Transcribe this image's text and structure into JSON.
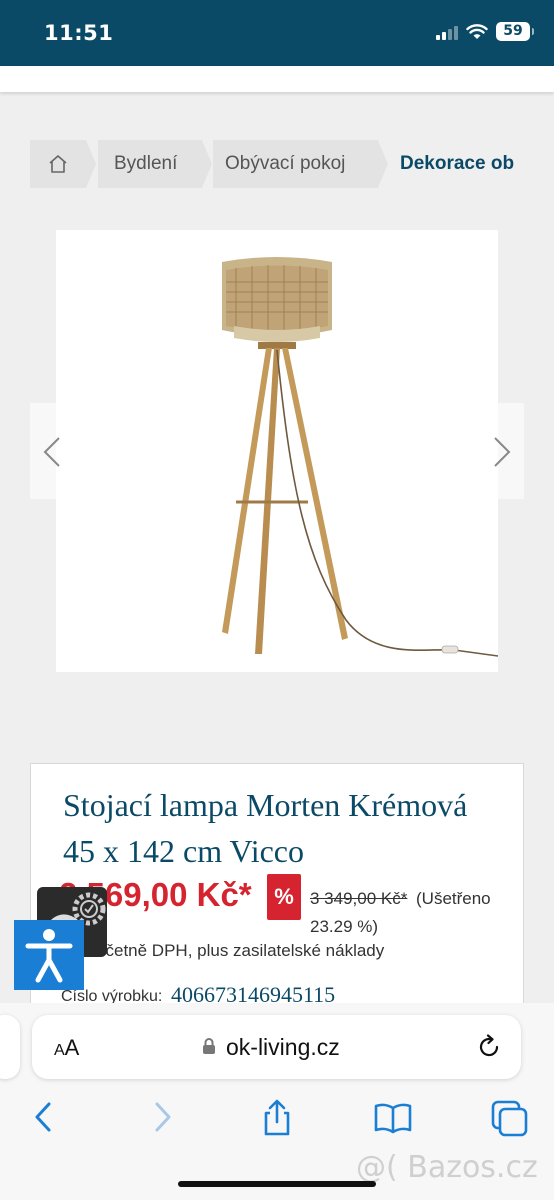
{
  "status_bar": {
    "time": "11:51",
    "battery": "59"
  },
  "breadcrumb": {
    "items": [
      "Bydlení",
      "Obývací pokoj"
    ],
    "current": "Dekorace ob"
  },
  "gallery": {
    "image_icon": "floor-lamp-image",
    "prev_icon": "chevron-left-icon",
    "next_icon": "chevron-right-icon"
  },
  "product": {
    "title": "Stojací lampa Morten Krémová 45 x 142 cm Vicco",
    "price_now": "2 569,00 Kč*",
    "discount_badge": "%",
    "price_old": "3 349,00 Kč*",
    "savings_line1": "(Ušetřeno",
    "savings_line2": "23.29 %)",
    "vat_note": "včetně DPH, plus zasilatelské náklady",
    "sku_label": "Číslo výrobku:",
    "sku_value": "40667314694511​5"
  },
  "browser": {
    "aa_small": "A",
    "aa_large": "A",
    "url": "ok-living.cz"
  },
  "watermark": "@( Bazos.cz",
  "colors": {
    "brand": "#0b4a66",
    "sale": "#d52430",
    "ios_blue": "#1a7fd4"
  }
}
